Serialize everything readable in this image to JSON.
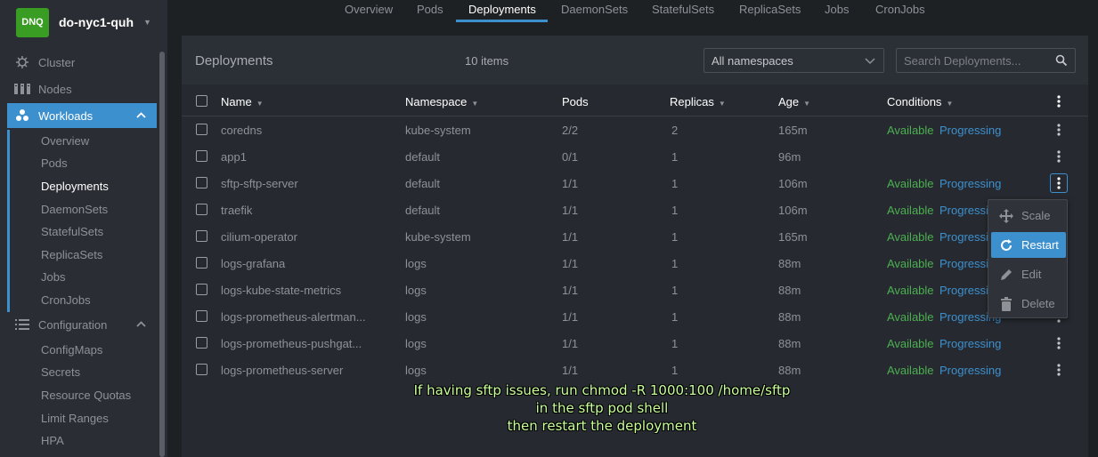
{
  "sidebar": {
    "cluster_badge": "DNQ",
    "cluster_name": "do-nyc1-quh",
    "items": [
      {
        "label": "Cluster",
        "icon": "helm-icon"
      },
      {
        "label": "Nodes",
        "icon": "nodes-icon"
      },
      {
        "label": "Workloads",
        "icon": "workloads-icon",
        "active": true
      },
      {
        "label": "Configuration",
        "icon": "list-icon"
      }
    ],
    "workloads_sub": [
      "Overview",
      "Pods",
      "Deployments",
      "DaemonSets",
      "StatefulSets",
      "ReplicaSets",
      "Jobs",
      "CronJobs"
    ],
    "config_sub": [
      "ConfigMaps",
      "Secrets",
      "Resource Quotas",
      "Limit Ranges",
      "HPA"
    ]
  },
  "tabs": [
    "Overview",
    "Pods",
    "Deployments",
    "DaemonSets",
    "StatefulSets",
    "ReplicaSets",
    "Jobs",
    "CronJobs"
  ],
  "active_tab": "Deployments",
  "panel": {
    "title": "Deployments",
    "count": "10 items",
    "namespace_select": "All namespaces",
    "search_placeholder": "Search Deployments..."
  },
  "table": {
    "headers": [
      "Name",
      "Namespace",
      "Pods",
      "Replicas",
      "Age",
      "Conditions"
    ],
    "rows": [
      {
        "name": "coredns",
        "namespace": "kube-system",
        "pods": "2/2",
        "replicas": "2",
        "age": "165m",
        "available": "Available",
        "progressing": "Progressing"
      },
      {
        "name": "app1",
        "namespace": "default",
        "pods": "0/1",
        "replicas": "1",
        "age": "96m",
        "available": "",
        "progressing": ""
      },
      {
        "name": "sftp-sftp-server",
        "namespace": "default",
        "pods": "1/1",
        "replicas": "1",
        "age": "106m",
        "available": "Available",
        "progressing": "Progressing"
      },
      {
        "name": "traefik",
        "namespace": "default",
        "pods": "1/1",
        "replicas": "1",
        "age": "106m",
        "available": "Available",
        "progressing": "Progressing"
      },
      {
        "name": "cilium-operator",
        "namespace": "kube-system",
        "pods": "1/1",
        "replicas": "1",
        "age": "165m",
        "available": "Available",
        "progressing": "Progressing"
      },
      {
        "name": "logs-grafana",
        "namespace": "logs",
        "pods": "1/1",
        "replicas": "1",
        "age": "88m",
        "available": "Available",
        "progressing": "Progressing"
      },
      {
        "name": "logs-kube-state-metrics",
        "namespace": "logs",
        "pods": "1/1",
        "replicas": "1",
        "age": "88m",
        "available": "Available",
        "progressing": "Progressing"
      },
      {
        "name": "logs-prometheus-alertman...",
        "namespace": "logs",
        "pods": "1/1",
        "replicas": "1",
        "age": "88m",
        "available": "Available",
        "progressing": "Progressing"
      },
      {
        "name": "logs-prometheus-pushgat...",
        "namespace": "logs",
        "pods": "1/1",
        "replicas": "1",
        "age": "88m",
        "available": "Available",
        "progressing": "Progressing"
      },
      {
        "name": "logs-prometheus-server",
        "namespace": "logs",
        "pods": "1/1",
        "replicas": "1",
        "age": "88m",
        "available": "Available",
        "progressing": "Progressing"
      }
    ]
  },
  "context_menu": [
    "Scale",
    "Restart",
    "Edit",
    "Delete"
  ],
  "subtitle": [
    "If having sftp issues, run chmod -R 1000:100 /home/sftp",
    "in the sftp pod shell",
    "then restart the deployment"
  ],
  "colors": {
    "accent": "#3d90ce",
    "available": "#4caf50",
    "badge": "#3a9d23"
  }
}
